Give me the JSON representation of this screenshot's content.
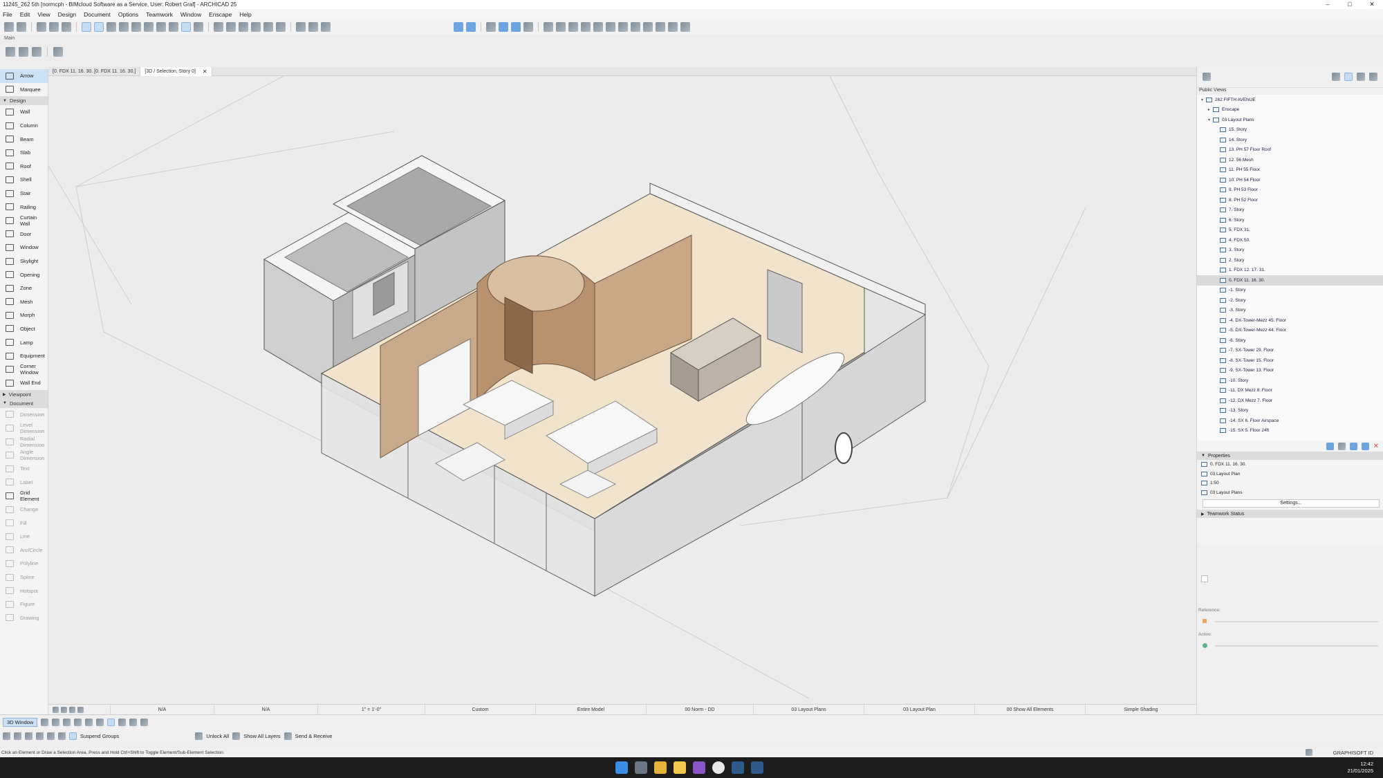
{
  "window": {
    "title": "11245_262 5th [normcph - BIMcloud Software as a Service, User: Robert Graf] - ARCHICAD 25",
    "controls": [
      "–",
      "□",
      "✕"
    ]
  },
  "menubar": [
    "File",
    "Edit",
    "View",
    "Design",
    "Document",
    "Options",
    "Teamwork",
    "Window",
    "Enscape",
    "Help"
  ],
  "main_label": "Main",
  "toolbox": {
    "select_items": [
      {
        "label": "Arrow",
        "active": true
      },
      {
        "label": "Marquee",
        "active": false
      }
    ],
    "sections": [
      {
        "title": "Design",
        "items": [
          "Wall",
          "Column",
          "Beam",
          "Slab",
          "Roof",
          "Shell",
          "Stair",
          "Railing",
          "Curtain Wall",
          "Door",
          "Window",
          "Skylight",
          "Opening",
          "Zone",
          "Mesh",
          "Morph",
          "Object",
          "Lamp",
          "Equipment",
          "Corner Window",
          "Wall End"
        ]
      },
      {
        "title": "Viewpoint",
        "items": []
      },
      {
        "title": "Document",
        "items": [
          "Dimension",
          "Level Dimension",
          "Radial Dimension",
          "Angle Dimension",
          "Text",
          "Label",
          "Grid Element",
          "Change",
          "Fill",
          "Line",
          "Arc/Circle",
          "Polyline",
          "Spline",
          "Hotspot",
          "Figure",
          "Drawing"
        ]
      }
    ]
  },
  "tabs": [
    {
      "label": "[0. FDX 11. 16. 30. [0. FDX 11. 16. 30.]",
      "active": false
    },
    {
      "label": "[3D / Selection, Story 0]",
      "active": true,
      "close": "✕"
    }
  ],
  "viewport_status": [
    {
      "value": "N/A"
    },
    {
      "value": "N/A"
    },
    {
      "value": "1\" = 1'-0\""
    },
    {
      "value": "Custom"
    },
    {
      "value": "Entire Model"
    },
    {
      "value": "00 Norm - DD"
    },
    {
      "value": "03 Layout Plans"
    },
    {
      "value": "03 Layout Plan"
    },
    {
      "value": "00 Show All Elements"
    },
    {
      "value": "Simple Shading"
    }
  ],
  "bottom_toolbar": {
    "window_button": "3D Window",
    "suspend_groups": "Suspend Groups",
    "unlock_all": "Unlock All",
    "show_all_layers": "Show All Layers",
    "send_receive": "Send & Receive"
  },
  "status_line": "Click an Element or Draw a Selection Area. Press and Hold Ctrl+Shift to Toggle Element/Sub-Element Selection.",
  "brand": "GRAPHISOFT ID",
  "navigator": {
    "view_label": "Public Views",
    "tree": [
      {
        "label": "262 FIFTH AVENUE",
        "level": 0,
        "expand": "▾",
        "selected": false
      },
      {
        "label": "Enscape",
        "level": 1,
        "expand": "▸",
        "selected": false
      },
      {
        "label": "03 Layout Plans",
        "level": 1,
        "expand": "▾",
        "selected": false
      },
      {
        "label": "15. Story",
        "level": 2,
        "selected": false
      },
      {
        "label": "14. Story",
        "level": 2,
        "selected": false
      },
      {
        "label": "13. PH 57 Floor Roof",
        "level": 2,
        "selected": false
      },
      {
        "label": "12. 56 Mesh",
        "level": 2,
        "selected": false
      },
      {
        "label": "11. PH 55 Floor",
        "level": 2,
        "selected": false
      },
      {
        "label": "10. PH 54 Floor",
        "level": 2,
        "selected": false
      },
      {
        "label": "9. PH 53 Floor",
        "level": 2,
        "selected": false
      },
      {
        "label": "8. PH 52 Floor",
        "level": 2,
        "selected": false
      },
      {
        "label": "7. Story",
        "level": 2,
        "selected": false
      },
      {
        "label": "6. Story",
        "level": 2,
        "selected": false
      },
      {
        "label": "5. FDX 31.",
        "level": 2,
        "selected": false
      },
      {
        "label": "4. FDX 50.",
        "level": 2,
        "selected": false
      },
      {
        "label": "3. Story",
        "level": 2,
        "selected": false
      },
      {
        "label": "2. Story",
        "level": 2,
        "selected": false
      },
      {
        "label": "1. FDX 12. 17. 31.",
        "level": 2,
        "selected": false
      },
      {
        "label": "0. FDX 11. 16. 30.",
        "level": 2,
        "selected": true
      },
      {
        "label": "-1. Story",
        "level": 2,
        "selected": false
      },
      {
        "label": "-2. Story",
        "level": 2,
        "selected": false
      },
      {
        "label": "-3. Story",
        "level": 2,
        "selected": false
      },
      {
        "label": "-4. DX-Tower-Mezz 45. Floor",
        "level": 2,
        "selected": false
      },
      {
        "label": "-5. DX-Tower-Mezz 44. Floor",
        "level": 2,
        "selected": false
      },
      {
        "label": "-6. Story",
        "level": 2,
        "selected": false
      },
      {
        "label": "-7. SX-Tower 29. Floor",
        "level": 2,
        "selected": false
      },
      {
        "label": "-8. SX-Tower 15. Floor",
        "level": 2,
        "selected": false
      },
      {
        "label": "-9. SX-Tower 13. Floor",
        "level": 2,
        "selected": false
      },
      {
        "label": "-10. Story",
        "level": 2,
        "selected": false
      },
      {
        "label": "-11. DX Mezz 8. Floor",
        "level": 2,
        "selected": false
      },
      {
        "label": "-12. DX Mezz 7. Floor",
        "level": 2,
        "selected": false
      },
      {
        "label": "-13. Story",
        "level": 2,
        "selected": false
      },
      {
        "label": "-14. SX 6. Floor Airspace",
        "level": 2,
        "selected": false
      },
      {
        "label": "-15. SX 5. Floor 24ft",
        "level": 2,
        "selected": false
      }
    ]
  },
  "properties": {
    "title": "Properties",
    "rows": [
      "0. FDX 11. 16. 30.",
      "03 Layout Plan",
      "1:50",
      "03 Layout Plans"
    ],
    "settings_button": "Settings...",
    "teamwork_status": "Teamwork Status"
  },
  "reference_panel": {
    "reference_label": "Reference:",
    "active_label": "Active:"
  },
  "clock": {
    "time": "12:42",
    "date": "21/01/2025"
  }
}
